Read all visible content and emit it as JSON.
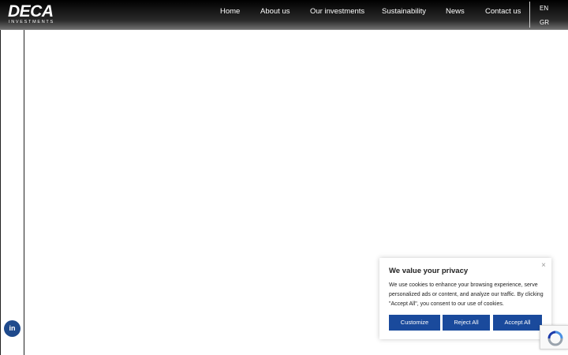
{
  "logo": {
    "main": "DECA",
    "sub": "INVESTMENTS"
  },
  "nav": {
    "items": [
      {
        "label": "Home"
      },
      {
        "label": "About us"
      },
      {
        "label": "Our investments"
      },
      {
        "label": "Sustainability"
      },
      {
        "label": "News"
      },
      {
        "label": "Contact us"
      }
    ]
  },
  "languages": [
    "EN",
    "GR"
  ],
  "social": {
    "linkedin_glyph": "in"
  },
  "cookie_banner": {
    "title": "We value your privacy",
    "text": "We use cookies to enhance your browsing experience, serve personalized ads or content, and analyze our traffic. By clicking \"Accept All\", you consent to our use of cookies.",
    "close_glyph": "×",
    "buttons": {
      "customize": "Customize",
      "reject": "Reject All",
      "accept": "Accept All"
    }
  },
  "colors": {
    "brand_blue": "#1a4a9c",
    "linkedin_blue": "#1f4a8c",
    "header_dark": "#000000"
  }
}
